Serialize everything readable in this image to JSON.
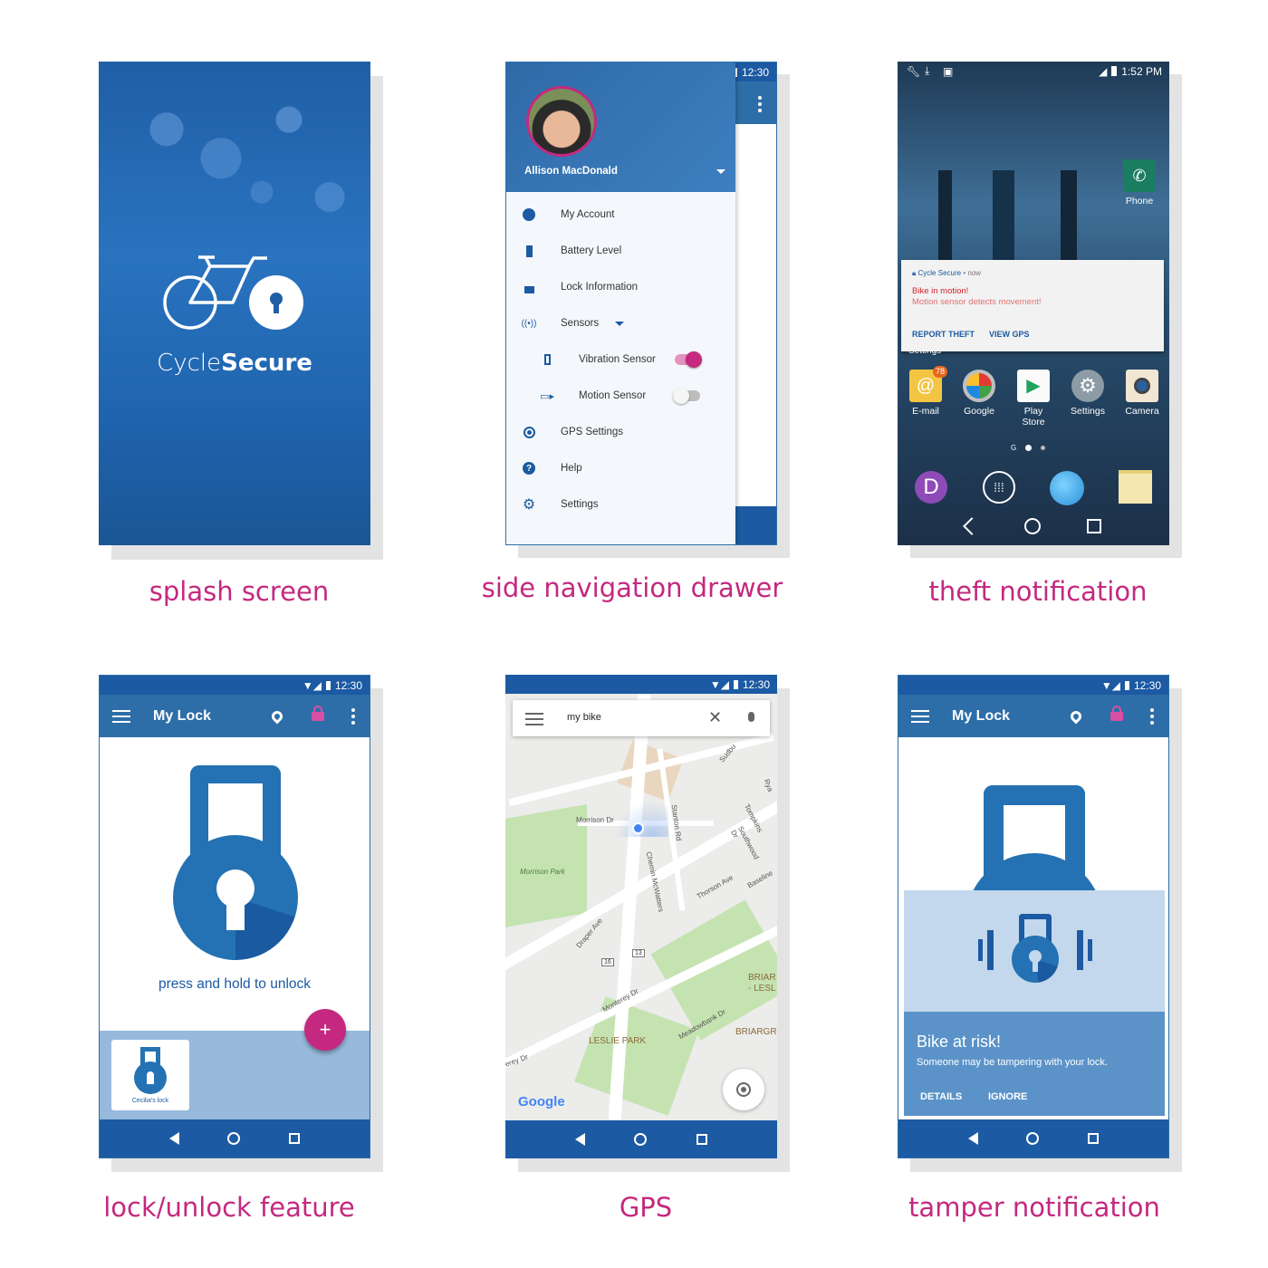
{
  "captions": {
    "splash": "splash screen",
    "drawer": "side navigation drawer",
    "theft": "theft notification",
    "lock": "lock/unlock feature",
    "gps": "GPS",
    "tamper": "tamper notification"
  },
  "colors": {
    "caption": "#c4297f",
    "primary": "#1c5aa3",
    "accent": "#c4297f",
    "appbar": "#2d6ea8"
  },
  "status": {
    "time": "12:30",
    "theft_time": "1:52 PM"
  },
  "splash": {
    "brand_light": "Cycle",
    "brand_bold": "Secure"
  },
  "drawer": {
    "user_name": "Allison MacDonald",
    "items": [
      {
        "label": "My Account",
        "icon": "account-circle-icon"
      },
      {
        "label": "Battery Level",
        "icon": "battery-icon"
      },
      {
        "label": "Lock Information",
        "icon": "lock-icon"
      },
      {
        "label": "Sensors",
        "icon": "sensors-icon"
      },
      {
        "label": "Vibration Sensor",
        "icon": "vibration-icon",
        "on": true
      },
      {
        "label": "Motion Sensor",
        "icon": "motion-icon",
        "on": false
      },
      {
        "label": "GPS Settings",
        "icon": "gps-icon"
      },
      {
        "label": "Help",
        "icon": "help-icon"
      },
      {
        "label": "Settings",
        "icon": "gear-icon"
      }
    ]
  },
  "theft": {
    "notif_app": "Cycle Secure",
    "notif_meta": "• now",
    "notif_title": "Bike in motion!",
    "notif_body": "Motion sensor detects movement!",
    "action_report": "REPORT THEFT",
    "action_gps": "VIEW GPS",
    "phone_label": "Phone",
    "settings_partial": "Settings",
    "email_badge": "78",
    "apps": [
      "E-mail",
      "Google",
      "Play Store",
      "Settings",
      "Camera"
    ],
    "dock_letter": "D"
  },
  "lock": {
    "title": "My Lock",
    "hint": "press and hold to unlock",
    "fab": "+",
    "card_label": "Cecilia's lock"
  },
  "gps": {
    "search_value": "my bike",
    "streets": [
      "Morrison Dr",
      "Morrison Park",
      "Stanton Rd",
      "Tompkins",
      "Southwood Dr",
      "Chemin McWatters",
      "Thorson Ave",
      "Baseline",
      "Draper Ave",
      "Monterey Dr",
      "Meadowbank Dr",
      "LESLIE PARK",
      "BRIAR - LESL",
      "BRIARGR",
      "16",
      "13",
      "erey Dr",
      "Sudbu",
      "Rya"
    ],
    "logo": "Google"
  },
  "tamper": {
    "title": "My Lock",
    "alert_title": "Bike at risk!",
    "alert_body": "Someone may be tampering with your lock.",
    "action_details": "DETAILS",
    "action_ignore": "IGNORE"
  }
}
